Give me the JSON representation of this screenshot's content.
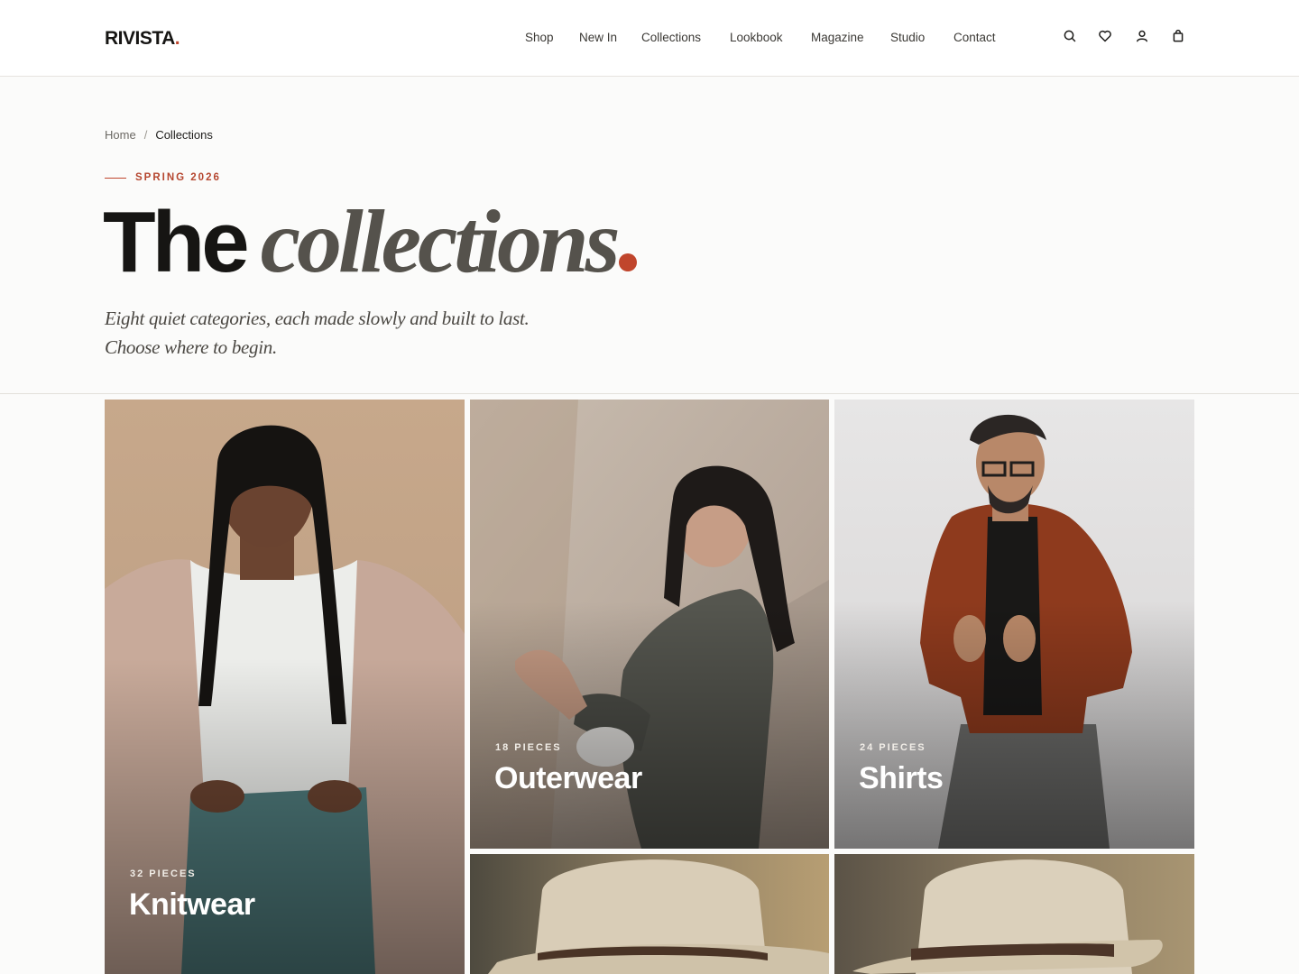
{
  "brand": {
    "name": "RIVISTA",
    "dot": "."
  },
  "nav": {
    "items": [
      "Shop",
      "New In",
      "Collections",
      "Lookbook",
      "Magazine",
      "Studio",
      "Contact"
    ]
  },
  "header_icons": [
    "search-icon",
    "heart-icon",
    "user-icon",
    "bag-icon"
  ],
  "breadcrumb": {
    "home": "Home",
    "separator": "/",
    "current": "Collections"
  },
  "eyebrow": "SPRING 2026",
  "headline": {
    "strong": "The",
    "italic": "collections"
  },
  "lede": {
    "line1": "Eight quiet categories, each made slowly and built to last.",
    "line2": "Choose where to begin."
  },
  "collections": [
    {
      "count": "32 PIECES",
      "name": "Knitwear"
    },
    {
      "count": "18 PIECES",
      "name": "Outerwear"
    },
    {
      "count": "24 PIECES",
      "name": "Shirts"
    },
    {
      "count": "",
      "name": ""
    },
    {
      "count": "",
      "name": ""
    }
  ],
  "colors": {
    "accent": "#c0452c",
    "ink": "#161513",
    "background": "#fbfbfa"
  }
}
